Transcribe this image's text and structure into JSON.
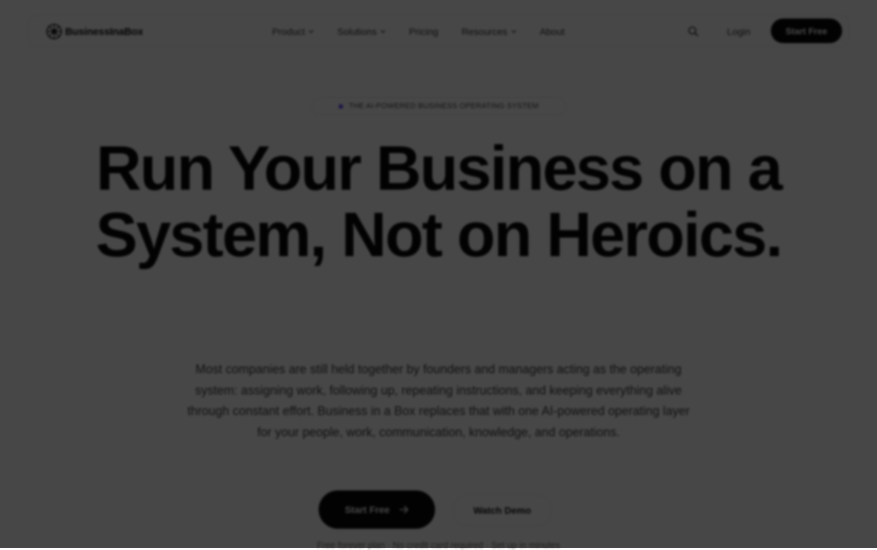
{
  "brand": {
    "name": "BusinessInaBox"
  },
  "nav": {
    "items": [
      {
        "label": "Product",
        "has_dropdown": true
      },
      {
        "label": "Solutions",
        "has_dropdown": true
      },
      {
        "label": "Pricing",
        "has_dropdown": false
      },
      {
        "label": "Resources",
        "has_dropdown": true
      },
      {
        "label": "About",
        "has_dropdown": false
      }
    ],
    "search_icon": "search-icon",
    "login_label": "Login",
    "cta_label": "Start Free"
  },
  "hero": {
    "badge": "THE AI-POWERED BUSINESS OPERATING SYSTEM",
    "headline": "Run Your Business on a System, Not on Heroics.",
    "lead": "Most companies are still held together by founders and managers acting as the operating system: assigning work, following up, repeating instructions, and keeping everything alive through constant effort. Business in a Box replaces that with one AI-powered operating layer for your people, work, communication, knowledge, and operations.",
    "primary_cta": "Start Free",
    "secondary_cta": "Watch Demo",
    "footnote": "Free forever plan · No credit card required · Set up in minutes"
  },
  "colors": {
    "accent": "#6b5cff",
    "primary": "#0a0a0a",
    "overlay": "rgba(0,0,0,0.72)"
  }
}
